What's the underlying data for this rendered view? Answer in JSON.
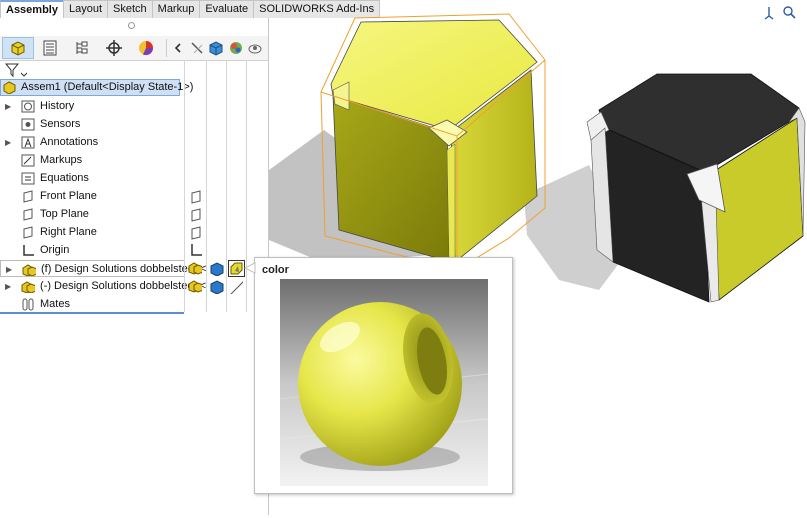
{
  "tabs": [
    {
      "label": "Assembly",
      "active": true
    },
    {
      "label": "Layout",
      "active": false
    },
    {
      "label": "Sketch",
      "active": false
    },
    {
      "label": "Markup",
      "active": false
    },
    {
      "label": "Evaluate",
      "active": false
    },
    {
      "label": "SOLIDWORKS Add-Ins",
      "active": false
    }
  ],
  "manager_tabs": [
    "feature-manager",
    "property-manager",
    "configuration-manager",
    "dimxpert-manager",
    "display-manager"
  ],
  "tree": {
    "root": "Assem1  (Default<Display State-1>)",
    "items": [
      {
        "label": "History",
        "expandable": true
      },
      {
        "label": "Sensors",
        "expandable": false
      },
      {
        "label": "Annotations",
        "expandable": true
      },
      {
        "label": "Markups",
        "expandable": false
      },
      {
        "label": "Equations",
        "expandable": false
      },
      {
        "label": "Front Plane",
        "expandable": false
      },
      {
        "label": "Top Plane",
        "expandable": false
      },
      {
        "label": "Right Plane",
        "expandable": false
      },
      {
        "label": "Origin",
        "expandable": false
      },
      {
        "label": "(f) Design Solutions dobbelsteen<",
        "expandable": true
      },
      {
        "label": "(-) Design Solutions dobbelsteen<",
        "expandable": true
      },
      {
        "label": "Mates",
        "expandable": false
      }
    ]
  },
  "popup": {
    "title": "color",
    "swatch_color": "#e6e64a"
  },
  "colors": {
    "accent": "#7aa7d8",
    "selection": "#cfe0f4",
    "cube_yellow": "#d8d830",
    "cube_dark": "#3d3d3d",
    "bbox_orange": "#f0a030"
  }
}
